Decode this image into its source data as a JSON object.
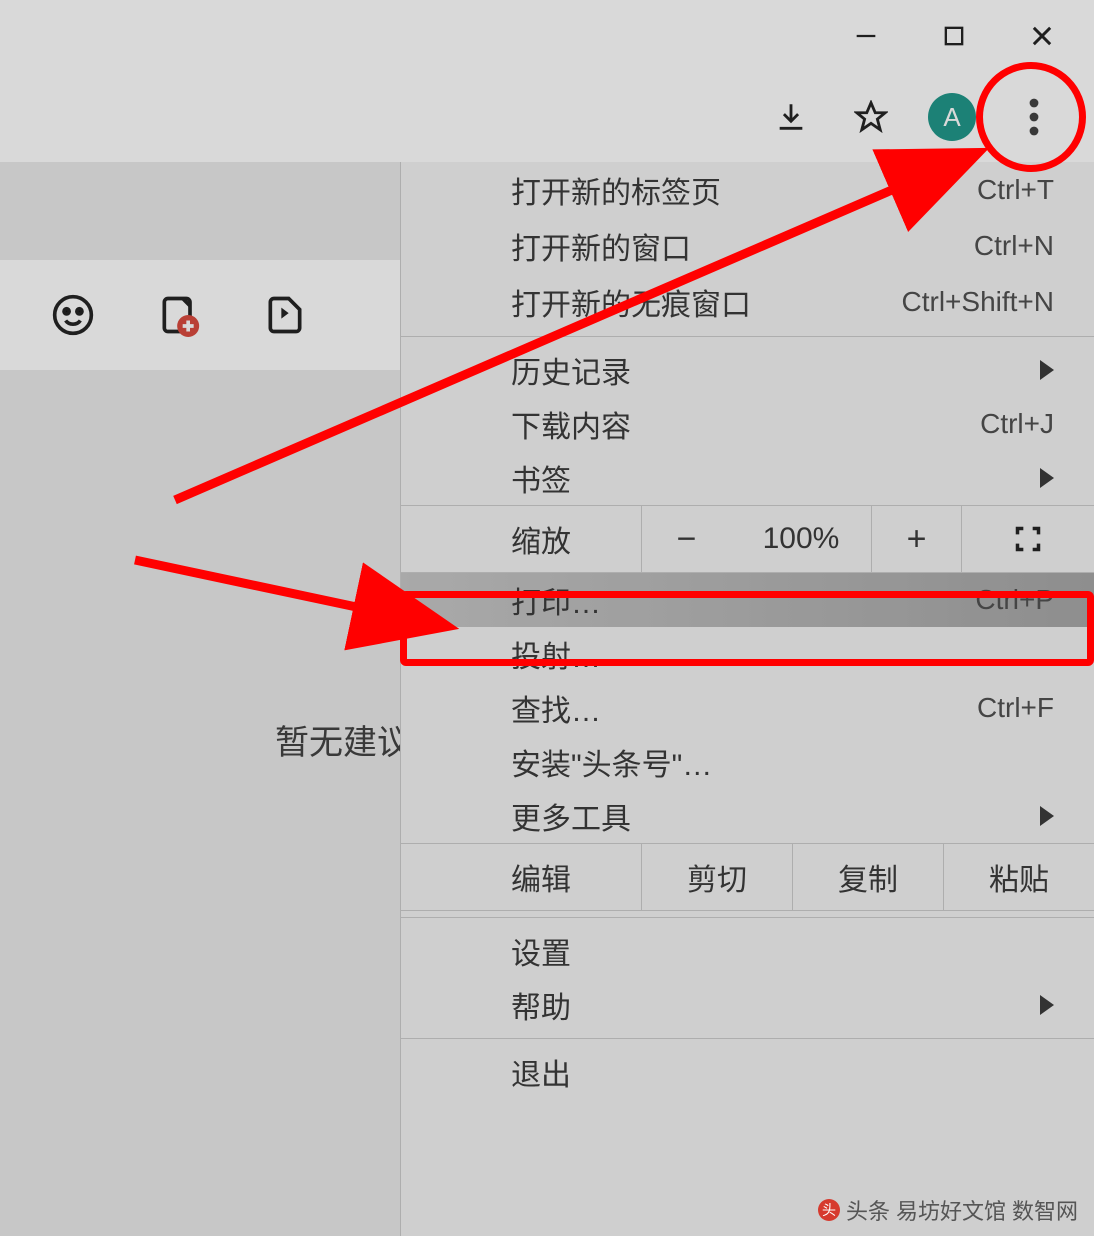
{
  "window": {
    "minimize": "−",
    "close": "×"
  },
  "toolbar": {
    "avatar_letter": "A"
  },
  "page": {
    "suggestion_text": "暂无建议"
  },
  "menu": {
    "new_tab": {
      "label": "打开新的标签页",
      "shortcut": "Ctrl+T"
    },
    "new_window": {
      "label": "打开新的窗口",
      "shortcut": "Ctrl+N"
    },
    "new_incognito": {
      "label": "打开新的无痕窗口",
      "shortcut": "Ctrl+Shift+N"
    },
    "history": {
      "label": "历史记录"
    },
    "downloads": {
      "label": "下载内容",
      "shortcut": "Ctrl+J"
    },
    "bookmarks": {
      "label": "书签"
    },
    "zoom": {
      "label": "缩放",
      "minus": "−",
      "value": "100%",
      "plus": "+"
    },
    "print": {
      "label": "打印…",
      "shortcut": "Ctrl+P"
    },
    "cast": {
      "label": "投射…"
    },
    "find": {
      "label": "查找…",
      "shortcut": "Ctrl+F"
    },
    "install": {
      "label": "安装\"头条号\"…"
    },
    "more_tools": {
      "label": "更多工具"
    },
    "edit": {
      "label": "编辑",
      "cut": "剪切",
      "copy": "复制",
      "paste": "粘贴"
    },
    "settings": {
      "label": "设置"
    },
    "help": {
      "label": "帮助"
    },
    "exit": {
      "label": "退出"
    }
  },
  "watermark": {
    "text1": "头条",
    "text2": "易坊好文馆",
    "text3": "数智网"
  }
}
